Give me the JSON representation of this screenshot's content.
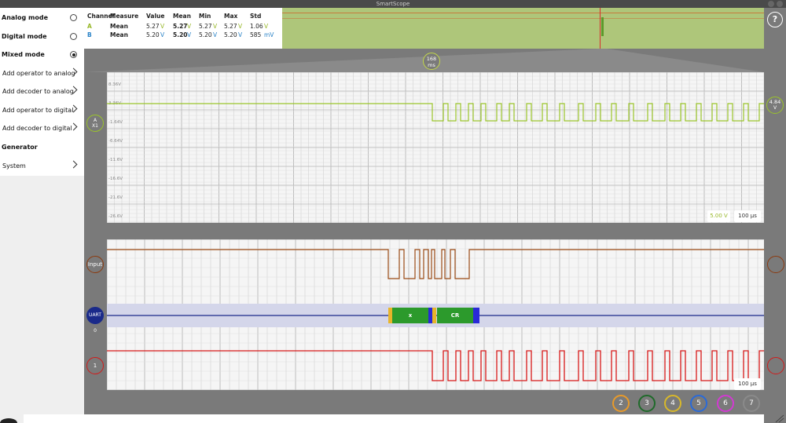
{
  "window": {
    "title": "SmartScope"
  },
  "sidebar": {
    "items": [
      {
        "label": "Analog mode",
        "kind": "radio",
        "selected": false,
        "bold": true
      },
      {
        "label": "Digital mode",
        "kind": "radio",
        "selected": false,
        "bold": true
      },
      {
        "label": "Mixed mode",
        "kind": "radio",
        "selected": true,
        "bold": true
      },
      {
        "label": "Add operator to analog",
        "kind": "submenu"
      },
      {
        "label": "Add decoder to analog",
        "kind": "submenu"
      },
      {
        "label": "Add operator to digital",
        "kind": "submenu"
      },
      {
        "label": "Add decoder to digital",
        "kind": "submenu"
      },
      {
        "label": "Generator",
        "kind": "header",
        "bold": true
      },
      {
        "label": "System",
        "kind": "submenu"
      }
    ]
  },
  "measurements": {
    "headers": [
      "Channel",
      "Measure",
      "Value",
      "Mean",
      "Min",
      "Max",
      "Std"
    ],
    "rows": [
      {
        "channel": "A",
        "measure": "Mean",
        "value": "5.27",
        "value_unit": "V",
        "mean": "5.27",
        "mean_unit": "V",
        "min": "5.27",
        "min_unit": "V",
        "max": "5.27",
        "max_unit": "V",
        "std": "1.06",
        "std_unit": "V"
      },
      {
        "channel": "B",
        "measure": "Mean",
        "value": "5.20",
        "value_unit": "V",
        "mean": "5.20",
        "mean_unit": "V",
        "min": "5.20",
        "min_unit": "V",
        "max": "5.20",
        "max_unit": "V",
        "std": "585",
        "std_unit": "mV"
      }
    ]
  },
  "help": {
    "label": "?"
  },
  "zoom_marker": {
    "value": "168",
    "unit": "ms"
  },
  "analog": {
    "y_labels": [
      "8.36V",
      "3.36V",
      "-1.64V",
      "-6.64V",
      "-11.6V",
      "-16.6V",
      "-21.6V",
      "-26.6V"
    ],
    "channel_marker": {
      "label": "A",
      "sub": "X1"
    },
    "right_marker": {
      "value": "4.84",
      "unit": "V"
    },
    "vdiv": "5.00 V",
    "tdiv": "100 µs"
  },
  "digital": {
    "channels": [
      {
        "label": "Input",
        "color": "#8b3a0f"
      },
      {
        "label": "UART 0",
        "color": "#1a2a8a"
      },
      {
        "label": "1",
        "color": "#d21a1a"
      }
    ],
    "uart_frames": [
      "x",
      "CR"
    ],
    "tdiv": "100 µs"
  },
  "bottom_channels": [
    {
      "label": "2",
      "color": "#e89a2a"
    },
    {
      "label": "3",
      "color": "#1f6a2a"
    },
    {
      "label": "4",
      "color": "#d8b82a"
    },
    {
      "label": "5",
      "color": "#2a6ad8"
    },
    {
      "label": "6",
      "color": "#d23ad2"
    },
    {
      "label": "7",
      "color": "#8a8a8a"
    }
  ],
  "colors": {
    "analog_trace": "#9bc52a",
    "input_trace": "#9a4a14",
    "uart_trace": "#1a2a8a",
    "ch1_trace": "#d81818",
    "uart_frame": "#2c9a2c",
    "uart_start": "#e8b42a",
    "uart_stop": "#2a2ad8"
  }
}
